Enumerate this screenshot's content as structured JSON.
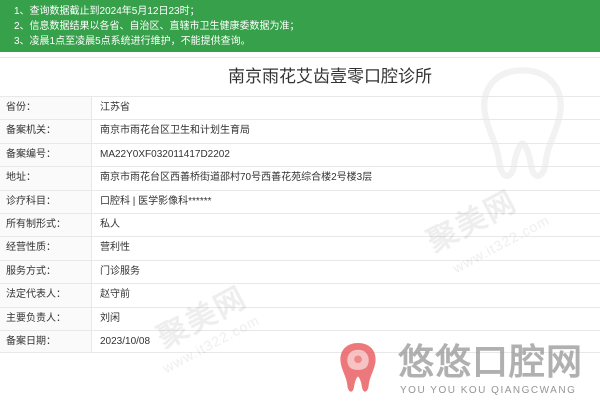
{
  "notices": [
    "1、查询数据截止到2024年5月12日23时；",
    "2、信息数据结果以各省、自治区、直辖市卫生健康委数据为准；",
    "3、凌晨1点至凌晨5点系统进行维护，不能提供查询。"
  ],
  "clinic": {
    "name": "南京雨花艾齿壹零口腔诊所",
    "rows": [
      {
        "label": "省份：",
        "value": "江苏省"
      },
      {
        "label": "备案机关：",
        "value": "南京市雨花台区卫生和计划生育局"
      },
      {
        "label": "备案编号：",
        "value": "MA22Y0XF032011417D2202"
      },
      {
        "label": "地址：",
        "value": "南京市雨花台区西善桥街道邵村70号西善花苑综合楼2号楼3层"
      },
      {
        "label": "诊疗科目：",
        "value": "口腔科 | 医学影像科******"
      },
      {
        "label": "所有制形式：",
        "value": "私人"
      },
      {
        "label": "经营性质：",
        "value": "营利性"
      },
      {
        "label": "服务方式：",
        "value": "门诊服务"
      },
      {
        "label": "法定代表人：",
        "value": "赵守前"
      },
      {
        "label": "主要负责人：",
        "value": "刘闲"
      },
      {
        "label": "备案日期：",
        "value": "2023/10/08"
      }
    ]
  },
  "watermarks": {
    "site_name": "聚美网",
    "site_url": "www.it322.com",
    "icon": "tooth-watermark-icon"
  },
  "logo": {
    "name": "悠悠口腔网",
    "subtitle": "YOU YOU KOU QIANGCWANG",
    "icon": "tooth-icon"
  },
  "colors": {
    "banner": "#36a14a",
    "text": "#333333",
    "border": "#e8e8e8",
    "logo_icon": "#e84c4f",
    "logo_text": "#969696"
  }
}
